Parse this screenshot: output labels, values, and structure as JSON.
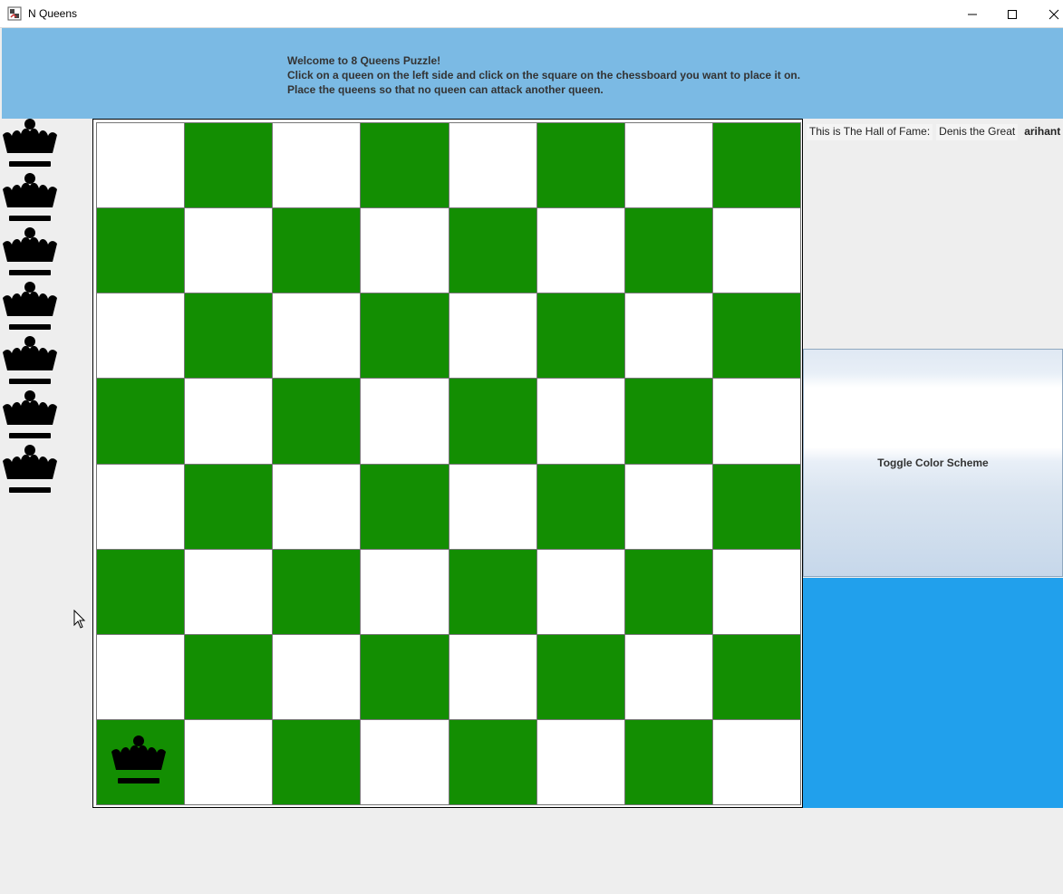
{
  "window": {
    "title": "N Queens",
    "icon": "java-app-icon",
    "controls": [
      "minimize-icon",
      "maximize-icon",
      "close-icon"
    ]
  },
  "banner": {
    "lines": [
      "Welcome to 8 Queens Puzzle!",
      "Click on a queen on the left side and click on the square on the chessboard you want to place it on.",
      "Place the queens so that no queen can attack another queen."
    ]
  },
  "tray": {
    "queens_remaining": 7,
    "icon": "queen-icon"
  },
  "board": {
    "size": 8,
    "colors": {
      "light": "#ffffff",
      "dark": "#138e02"
    },
    "placed_queens": [
      {
        "row": 7,
        "col": 0
      }
    ]
  },
  "hall_of_fame": {
    "label": "This is The Hall of Fame:",
    "entries": [
      "Denis the Great",
      "arihant"
    ]
  },
  "toggle_button": {
    "label": "Toggle Color Scheme"
  },
  "colors": {
    "banner": "#7bbae4",
    "panel": "#21a0ec",
    "background": "#eeeeee"
  }
}
